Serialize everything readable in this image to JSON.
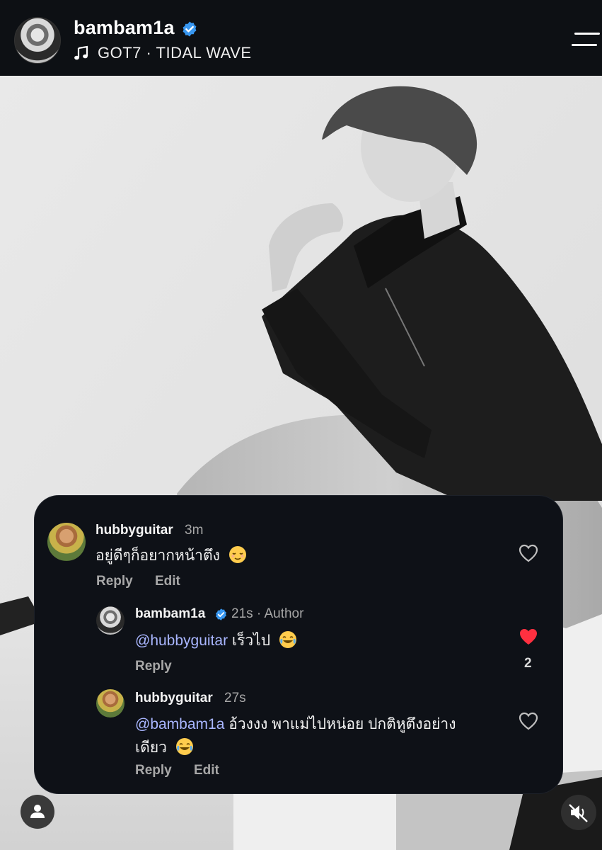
{
  "header": {
    "username": "bambam1a",
    "verified": true,
    "music": "GOT7 · TIDAL WAVE",
    "icons": [
      "verified-badge-icon",
      "music-note-icon",
      "menu-icon"
    ]
  },
  "comments": [
    {
      "username": "hubbyguitar",
      "time": "3m",
      "text": "อยู่ดีๆก็อยากหน้าตึง",
      "emoji": "relieved-face",
      "actions": [
        "Reply",
        "Edit"
      ],
      "liked": false
    },
    {
      "username": "bambam1a",
      "verified": true,
      "time": "21s · Author",
      "mention": "@hubbyguitar",
      "text": "เร็วไป",
      "emoji": "tears-of-joy",
      "actions": [
        "Reply"
      ],
      "liked": true,
      "like_count": "2"
    },
    {
      "username": "hubbyguitar",
      "time": "27s",
      "mention": "@bambam1a",
      "text_line1": "อ้วงงง พาแม่ไปหน่อย ปกติหูตึงอย่าง",
      "text_line2": "เดียว",
      "emoji": "tears-of-joy",
      "actions": [
        "Reply",
        "Edit"
      ],
      "liked": false
    }
  ],
  "colors": {
    "header_bg": "#0d1014",
    "card_bg": "#0e1117",
    "verified_blue": "#3897f0",
    "mention": "#a9b6ff",
    "heart_red": "#ff3040"
  }
}
